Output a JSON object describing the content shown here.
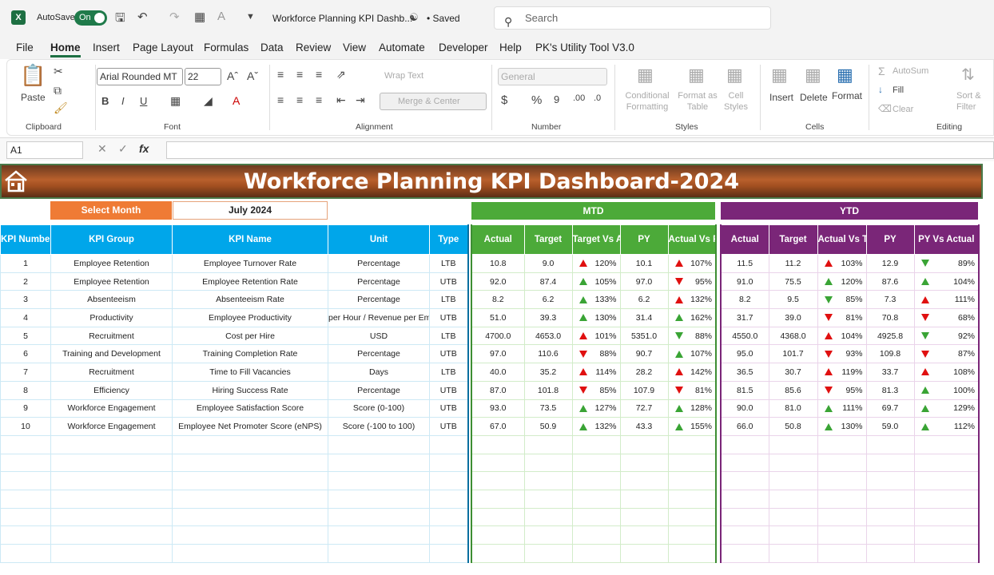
{
  "titlebar": {
    "autosave_label": "AutoSave",
    "toggle_state": "On",
    "doc_title": "Workforce Planning KPI Dashb...",
    "saved_label": "• Saved",
    "search_placeholder": "Search"
  },
  "menu": [
    "File",
    "Home",
    "Insert",
    "Page Layout",
    "Formulas",
    "Data",
    "Review",
    "View",
    "Automate",
    "Developer",
    "Help",
    "PK's Utility Tool V3.0"
  ],
  "ribbon": {
    "paste": "Paste",
    "clipboard": "Clipboard",
    "font_name": "Arial Rounded MT",
    "font_size": "22",
    "font": "Font",
    "wrap_text": "Wrap Text",
    "merge_center": "Merge & Center",
    "alignment": "Alignment",
    "number_format": "General",
    "number": "Number",
    "conditional_formatting": "Conditional Formatting",
    "format_as_table": "Format as Table",
    "cell_styles": "Cell Styles",
    "styles": "Styles",
    "insert": "Insert",
    "delete": "Delete",
    "format": "Format",
    "cells": "Cells",
    "autosum": "AutoSum",
    "fill": "Fill",
    "clear": "Clear",
    "sort_filter": "Sort & Filter",
    "editing": "Editing"
  },
  "formula_bar": {
    "name_box": "A1",
    "fx": "fx"
  },
  "dashboard": {
    "title": "Workforce Planning KPI Dashboard-2024",
    "select_month_label": "Select Month",
    "select_month_value": "July 2024",
    "mtd_label": "MTD",
    "ytd_label": "YTD",
    "kpi_headers": [
      "KPI Number",
      "KPI Group",
      "KPI Name",
      "Unit",
      "Type"
    ],
    "mtd_headers": [
      "Actual",
      "Target",
      "Target Vs Actual",
      "PY",
      "Actual Vs PY"
    ],
    "ytd_headers": [
      "Actual",
      "Target",
      "Actual Vs Target",
      "PY",
      "PY Vs Actual"
    ],
    "rows": [
      {
        "num": "1",
        "group": "Employee Retention",
        "name": "Employee Turnover Rate",
        "unit": "Percentage",
        "type": "LTB",
        "m_actual": "10.8",
        "m_target": "9.0",
        "m_tva": "120%",
        "m_tva_arrow": "up-r",
        "m_py": "10.1",
        "m_avp": "107%",
        "m_avp_arrow": "up-r",
        "y_actual": "11.5",
        "y_target": "11.2",
        "y_avt": "103%",
        "y_avt_arrow": "up-r",
        "y_py": "12.9",
        "y_pva": "89%",
        "y_pva_arrow": "dn-g"
      },
      {
        "num": "2",
        "group": "Employee Retention",
        "name": "Employee Retention Rate",
        "unit": "Percentage",
        "type": "UTB",
        "m_actual": "92.0",
        "m_target": "87.4",
        "m_tva": "105%",
        "m_tva_arrow": "up-g",
        "m_py": "97.0",
        "m_avp": "95%",
        "m_avp_arrow": "dn-r",
        "y_actual": "91.0",
        "y_target": "75.5",
        "y_avt": "120%",
        "y_avt_arrow": "up-g",
        "y_py": "87.6",
        "y_pva": "104%",
        "y_pva_arrow": "up-g"
      },
      {
        "num": "3",
        "group": "Absenteeism",
        "name": "Absenteeism Rate",
        "unit": "Percentage",
        "type": "LTB",
        "m_actual": "8.2",
        "m_target": "6.2",
        "m_tva": "133%",
        "m_tva_arrow": "up-g",
        "m_py": "6.2",
        "m_avp": "132%",
        "m_avp_arrow": "up-r",
        "y_actual": "8.2",
        "y_target": "9.5",
        "y_avt": "85%",
        "y_avt_arrow": "dn-g",
        "y_py": "7.3",
        "y_pva": "111%",
        "y_pva_arrow": "up-r"
      },
      {
        "num": "4",
        "group": "Productivity",
        "name": "Employee Productivity",
        "unit": "per Hour / Revenue per Emp",
        "type": "UTB",
        "m_actual": "51.0",
        "m_target": "39.3",
        "m_tva": "130%",
        "m_tva_arrow": "up-g",
        "m_py": "31.4",
        "m_avp": "162%",
        "m_avp_arrow": "up-g",
        "y_actual": "31.7",
        "y_target": "39.0",
        "y_avt": "81%",
        "y_avt_arrow": "dn-r",
        "y_py": "70.8",
        "y_pva": "68%",
        "y_pva_arrow": "dn-r"
      },
      {
        "num": "5",
        "group": "Recruitment",
        "name": "Cost per Hire",
        "unit": "USD",
        "type": "LTB",
        "m_actual": "4700.0",
        "m_target": "4653.0",
        "m_tva": "101%",
        "m_tva_arrow": "up-r",
        "m_py": "5351.0",
        "m_avp": "88%",
        "m_avp_arrow": "dn-g",
        "y_actual": "4550.0",
        "y_target": "4368.0",
        "y_avt": "104%",
        "y_avt_arrow": "up-r",
        "y_py": "4925.8",
        "y_pva": "92%",
        "y_pva_arrow": "dn-g"
      },
      {
        "num": "6",
        "group": "Training and Development",
        "name": "Training Completion Rate",
        "unit": "Percentage",
        "type": "UTB",
        "m_actual": "97.0",
        "m_target": "110.6",
        "m_tva": "88%",
        "m_tva_arrow": "dn-r",
        "m_py": "90.7",
        "m_avp": "107%",
        "m_avp_arrow": "up-g",
        "y_actual": "95.0",
        "y_target": "101.7",
        "y_avt": "93%",
        "y_avt_arrow": "dn-r",
        "y_py": "109.8",
        "y_pva": "87%",
        "y_pva_arrow": "dn-r"
      },
      {
        "num": "7",
        "group": "Recruitment",
        "name": "Time to Fill Vacancies",
        "unit": "Days",
        "type": "LTB",
        "m_actual": "40.0",
        "m_target": "35.2",
        "m_tva": "114%",
        "m_tva_arrow": "up-r",
        "m_py": "28.2",
        "m_avp": "142%",
        "m_avp_arrow": "up-r",
        "y_actual": "36.5",
        "y_target": "30.7",
        "y_avt": "119%",
        "y_avt_arrow": "up-r",
        "y_py": "33.7",
        "y_pva": "108%",
        "y_pva_arrow": "up-r"
      },
      {
        "num": "8",
        "group": "Efficiency",
        "name": "Hiring Success Rate",
        "unit": "Percentage",
        "type": "UTB",
        "m_actual": "87.0",
        "m_target": "101.8",
        "m_tva": "85%",
        "m_tva_arrow": "dn-r",
        "m_py": "107.9",
        "m_avp": "81%",
        "m_avp_arrow": "dn-r",
        "y_actual": "81.5",
        "y_target": "85.6",
        "y_avt": "95%",
        "y_avt_arrow": "dn-r",
        "y_py": "81.3",
        "y_pva": "100%",
        "y_pva_arrow": "up-g"
      },
      {
        "num": "9",
        "group": "Workforce Engagement",
        "name": "Employee Satisfaction Score",
        "unit": "Score (0-100)",
        "type": "UTB",
        "m_actual": "93.0",
        "m_target": "73.5",
        "m_tva": "127%",
        "m_tva_arrow": "up-g",
        "m_py": "72.7",
        "m_avp": "128%",
        "m_avp_arrow": "up-g",
        "y_actual": "90.0",
        "y_target": "81.0",
        "y_avt": "111%",
        "y_avt_arrow": "up-g",
        "y_py": "69.7",
        "y_pva": "129%",
        "y_pva_arrow": "up-g"
      },
      {
        "num": "10",
        "group": "Workforce Engagement",
        "name": "Employee Net Promoter Score (eNPS)",
        "unit": "Score (-100 to 100)",
        "type": "UTB",
        "m_actual": "67.0",
        "m_target": "50.9",
        "m_tva": "132%",
        "m_tva_arrow": "up-g",
        "m_py": "43.3",
        "m_avp": "155%",
        "m_avp_arrow": "up-g",
        "y_actual": "66.0",
        "y_target": "50.8",
        "y_avt": "130%",
        "y_avt_arrow": "up-g",
        "y_py": "59.0",
        "y_pva": "112%",
        "y_pva_arrow": "up-g"
      }
    ]
  }
}
